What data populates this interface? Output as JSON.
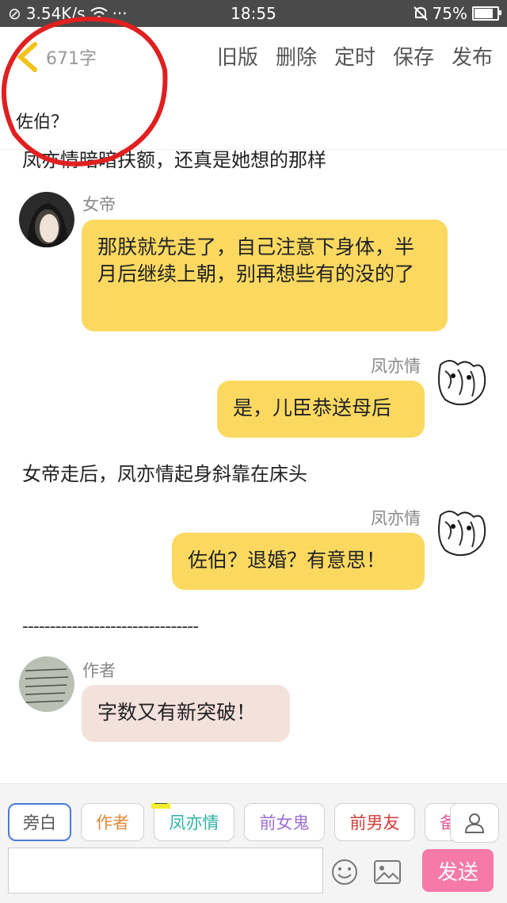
{
  "status_bar": {
    "speed": "3.54K/s",
    "dots": "···",
    "time": "18:55",
    "battery": "75%",
    "battery_fraction": 0.75
  },
  "header": {
    "word_count": "671字",
    "actions": [
      "旧版",
      "删除",
      "定时",
      "保存",
      "发布"
    ]
  },
  "title": "佐伯？",
  "chat": {
    "narration_top": "凤亦情暗暗扶额，还真是她想的那样",
    "messages": [
      {
        "speaker": "女帝",
        "text": "那朕就先走了，自己注意下身体，半月后继续上朝，别再想些有的没的了"
      },
      {
        "speaker": "凤亦情",
        "text": "是，儿臣恭送母后"
      },
      {
        "narration": "女帝走后，凤亦情起身斜靠在床头"
      },
      {
        "speaker": "凤亦情",
        "text": "佐伯？退婚？有意思！"
      },
      {
        "divider": "--------------------------------"
      },
      {
        "speaker": "作者",
        "text": "字数又有新突破！"
      }
    ]
  },
  "roles": {
    "items": [
      "旁白",
      "作者",
      "凤亦情",
      "前女鬼",
      "前男友",
      "备"
    ],
    "main_badge": "主"
  },
  "input": {
    "value": "",
    "placeholder": ""
  },
  "send_label": "发送",
  "colors": {
    "bubble": "#fbd961",
    "author_bubble": "#f3e1dc",
    "send": "#f57aa8",
    "annotation_circle": "#e02020"
  }
}
